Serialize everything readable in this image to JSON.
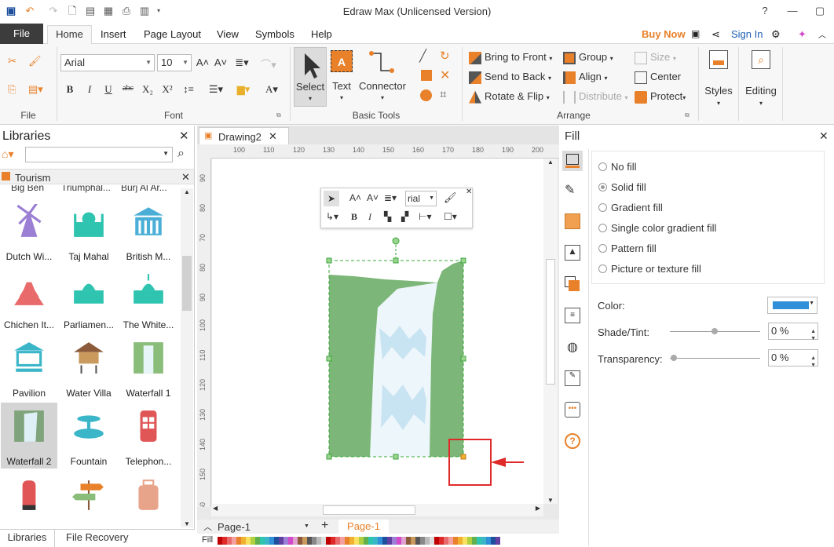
{
  "window": {
    "title": "Edraw Max (Unlicensed Version)"
  },
  "menu": {
    "file": "File",
    "tabs": [
      "Home",
      "Insert",
      "Page Layout",
      "View",
      "Symbols",
      "Help"
    ],
    "buy_now": "Buy Now",
    "sign_in": "Sign In"
  },
  "ribbon": {
    "groups": {
      "file": "File",
      "font": "Font",
      "basic_tools": "Basic Tools",
      "arrange": "Arrange"
    },
    "font_name": "Arial",
    "font_size": "10",
    "select": "Select",
    "text": "Text",
    "connector": "Connector",
    "bring_to_front": "Bring to Front",
    "send_to_back": "Send to Back",
    "rotate_flip": "Rotate & Flip",
    "group": "Group",
    "align": "Align",
    "distribute": "Distribute",
    "size": "Size",
    "center": "Center",
    "protect": "Protect",
    "styles": "Styles",
    "editing": "Editing"
  },
  "libraries": {
    "title": "Libraries",
    "category": "Tourism",
    "top_labels": [
      "Big Ben",
      "Triumphal...",
      "Burj Al Ar..."
    ],
    "items": [
      {
        "label": "Dutch Wi...",
        "color": "#9b7fd4"
      },
      {
        "label": "Taj Mahal",
        "color": "#2ec4b0"
      },
      {
        "label": "British M...",
        "color": "#4aaed6"
      },
      {
        "label": "Chichen It...",
        "color": "#e86a6a"
      },
      {
        "label": "Parliamen...",
        "color": "#2ec4b0"
      },
      {
        "label": "The White...",
        "color": "#2ec4b0"
      },
      {
        "label": "Pavilion",
        "color": "#3bb6c9"
      },
      {
        "label": "Water Villa",
        "color": "#c99a5c"
      },
      {
        "label": "Waterfall 1",
        "color": "#8bbd7a"
      },
      {
        "label": "Waterfall 2",
        "color": "#7fa37a"
      },
      {
        "label": "Fountain",
        "color": "#3bb6c9"
      },
      {
        "label": "Telephon...",
        "color": "#e05555"
      },
      {
        "label": "",
        "color": "#e05555"
      },
      {
        "label": "",
        "color": "#8bbd7a"
      },
      {
        "label": "",
        "color": "#e8a48a"
      }
    ],
    "bottom_tabs": [
      "Libraries",
      "File Recovery"
    ]
  },
  "document": {
    "tab": "Drawing2",
    "ruler_h": [
      "100",
      "110",
      "120",
      "130",
      "140",
      "150",
      "160",
      "170",
      "180",
      "190",
      "200"
    ],
    "ruler_v": [
      "90",
      "80",
      "70",
      "80",
      "90",
      "100",
      "110",
      "120",
      "130",
      "140",
      "150",
      "60"
    ],
    "mini_toolbar_font": "rial",
    "page_select": "Page-1",
    "active_page": "Page-1",
    "fill_label": "Fill"
  },
  "fill_panel": {
    "title": "Fill",
    "options": [
      "No fill",
      "Solid fill",
      "Gradient fill",
      "Single color gradient fill",
      "Pattern fill",
      "Picture or texture fill"
    ],
    "selected": "Solid fill",
    "color_label": "Color:",
    "color_value": "#2f8fd8",
    "shade_label": "Shade/Tint:",
    "shade_value": "0 %",
    "transparency_label": "Transparency:",
    "transparency_value": "0 %"
  },
  "colors": {
    "accent": "#e8812a",
    "file_tab": "#3c3c3c",
    "waterfall_green": "#7cb678",
    "selection_red": "#e02a2a"
  }
}
